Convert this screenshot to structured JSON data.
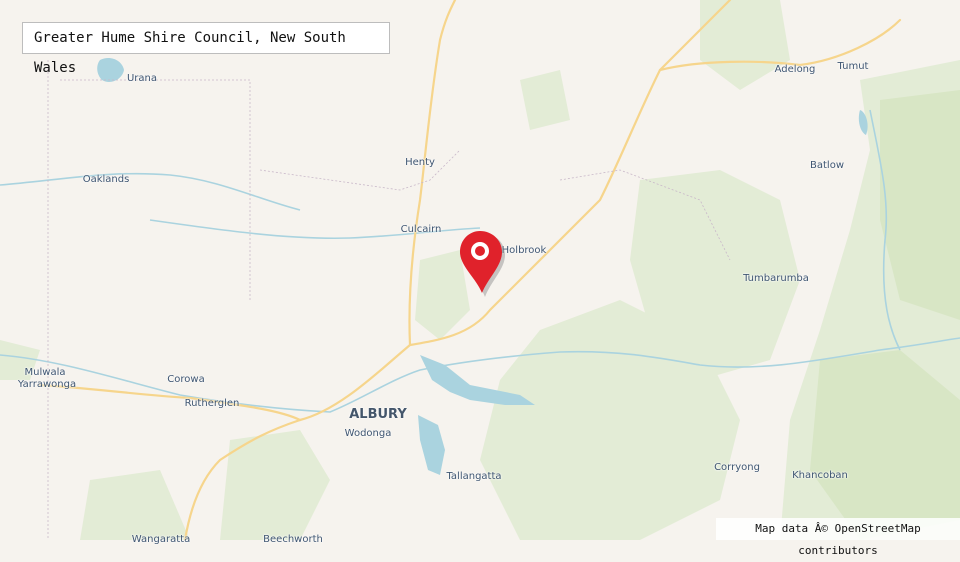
{
  "map": {
    "title": "Greater Hume Shire Council, New South Wales",
    "attribution": "Map data Â© OpenStreetMap contributors",
    "marker_icon": "location-pin-icon",
    "colors": {
      "land": "#f6f3ee",
      "forest": "#e3ecd6",
      "water": "#aad3df",
      "road": "#f6d58c",
      "marker": "#e0222b",
      "label": "#3f5672"
    },
    "places": [
      {
        "name": "Urana"
      },
      {
        "name": "Oaklands"
      },
      {
        "name": "Henty"
      },
      {
        "name": "Culcairn"
      },
      {
        "name": "Holbrook"
      },
      {
        "name": "Adelong"
      },
      {
        "name": "Tumut"
      },
      {
        "name": "Batlow"
      },
      {
        "name": "Tumbarumba"
      },
      {
        "name": "Mulwala"
      },
      {
        "name": "Yarrawonga"
      },
      {
        "name": "Corowa"
      },
      {
        "name": "Rutherglen"
      },
      {
        "name": "ALBURY"
      },
      {
        "name": "Wodonga"
      },
      {
        "name": "Tallangatta"
      },
      {
        "name": "Corryong"
      },
      {
        "name": "Khancoban"
      },
      {
        "name": "Wangaratta"
      },
      {
        "name": "Beechworth"
      }
    ]
  }
}
